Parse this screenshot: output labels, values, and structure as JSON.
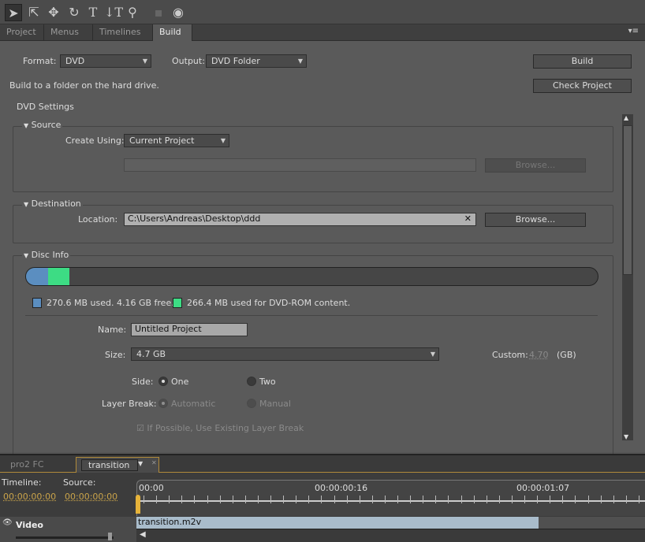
{
  "toolbar": {
    "tools": [
      "selection-tool",
      "direct-select-tool",
      "move-tool",
      "rotate-tool",
      "text-tool",
      "vertical-text-tool",
      "zoom-tool",
      "photoshop-tool",
      "preview-tool"
    ]
  },
  "tabs": [
    {
      "label": "Project"
    },
    {
      "label": "Menus"
    },
    {
      "label": "Timelines"
    },
    {
      "label": "Build",
      "active": true
    }
  ],
  "build": {
    "format_label": "Format:",
    "format_value": "DVD",
    "output_label": "Output:",
    "output_value": "DVD Folder",
    "build_button": "Build",
    "check_button": "Check Project",
    "description": "Build to a folder on the hard drive.",
    "settings_title": "DVD Settings",
    "source": {
      "title": "Source",
      "create_using_label": "Create Using:",
      "create_using_value": "Current Project",
      "path_value": "",
      "browse": "Browse..."
    },
    "destination": {
      "title": "Destination",
      "location_label": "Location:",
      "location_value": "C:\\Users\\Andreas\\Desktop\\ddd",
      "browse": "Browse..."
    },
    "disc_info": {
      "title": "Disc Info",
      "used_mb": 270.6,
      "dvdrom_mb": 266.4,
      "capacity_gb": 4.7,
      "used_color": "#5b8ec0",
      "dvdrom_color": "#3ddc84",
      "used_text": "270.6 MB used.  4.16 GB free.",
      "dvdrom_text": "266.4 MB used for DVD-ROM content.",
      "name_label": "Name:",
      "name_value": "Untitled Project",
      "size_label": "Size:",
      "size_value": "4.7 GB",
      "custom_label": "Custom:",
      "custom_value": "4.70",
      "custom_unit": "(GB)",
      "side_label": "Side:",
      "side_one": "One",
      "side_two": "Two",
      "side_selected": "One",
      "layer_break_label": "Layer Break:",
      "layer_auto": "Automatic",
      "layer_manual": "Manual",
      "existing_break": "If Possible, Use Existing Layer Break",
      "existing_break_checked": true
    }
  },
  "timeline": {
    "tabs": [
      {
        "label": "pro2 FC"
      },
      {
        "label": "transition",
        "active": true
      }
    ],
    "timeline_label": "Timeline:",
    "timeline_value": "00:00:00:00",
    "source_label": "Source:",
    "source_value": "00:00:00:00",
    "ruler": [
      "00:00",
      "00:00:00:16",
      "00:00:01:07"
    ],
    "track_label": "Video",
    "clip_name": "transition.m2v",
    "clip_end_fraction": 0.79
  }
}
